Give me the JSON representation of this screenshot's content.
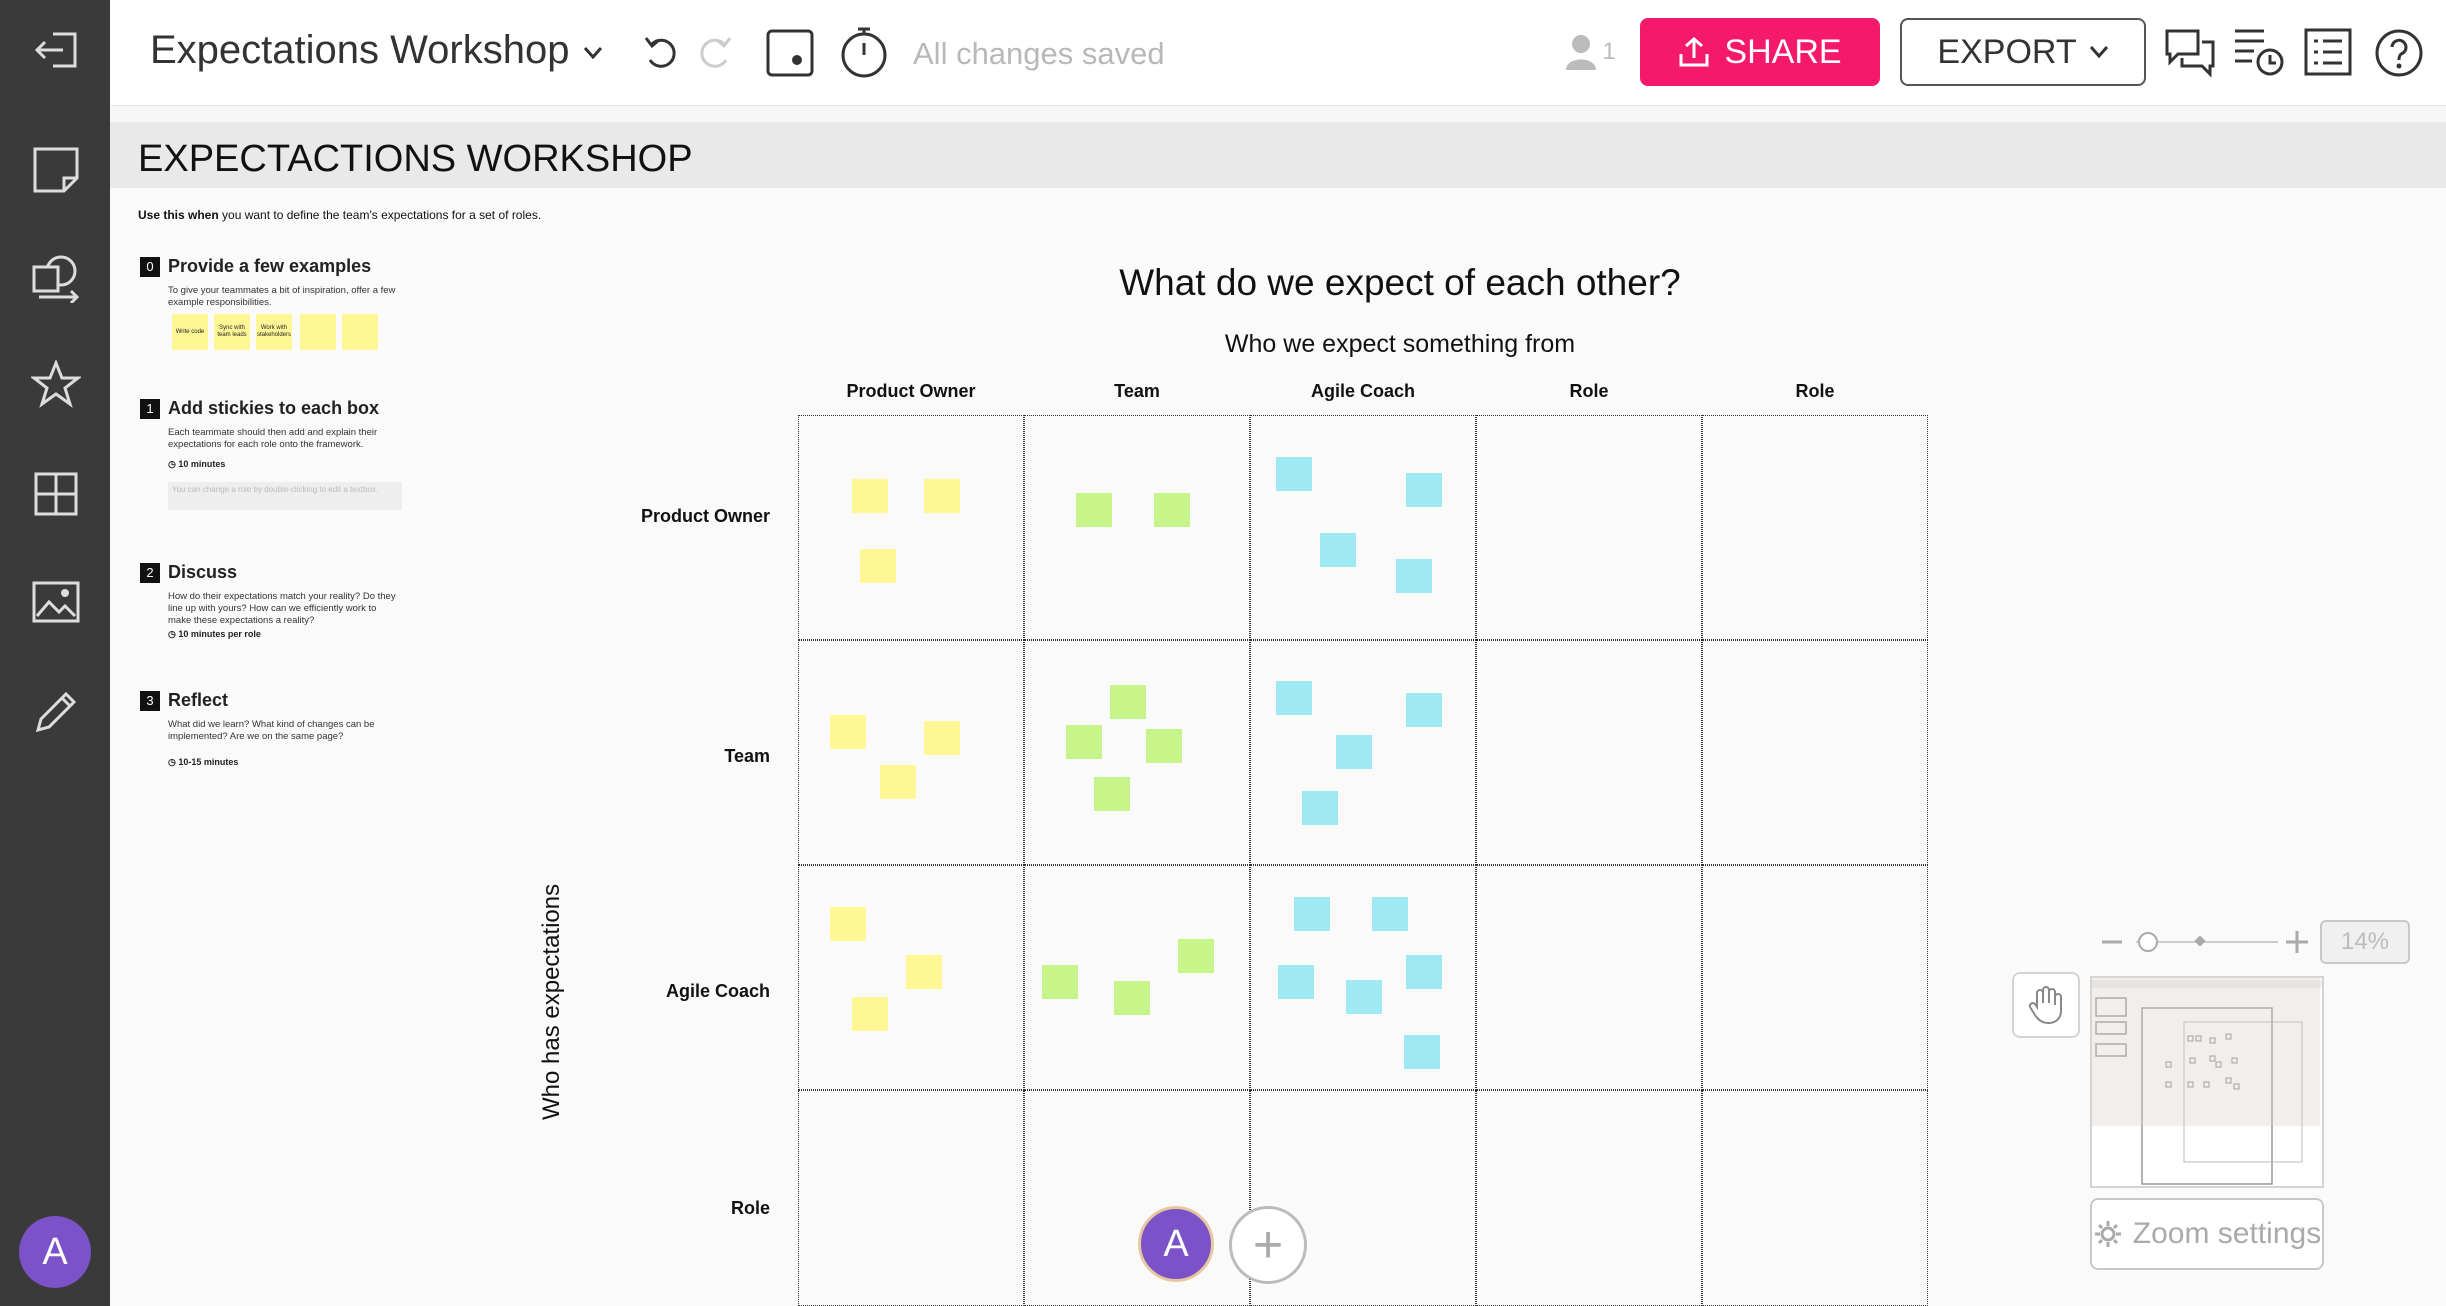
{
  "topbar": {
    "title": "Expectations Workshop",
    "saved_status": "All changes saved",
    "user_count": "1",
    "share_label": "SHARE",
    "export_label": "EXPORT"
  },
  "rail": {
    "avatar_initial": "A"
  },
  "board": {
    "title": "EXPECTACTIONS WORKSHOP",
    "intro_bold": "Use this when",
    "intro_rest": " you want to define the team's expectations for a set of roles.",
    "steps": [
      {
        "num": "0",
        "heading": "Provide a few examples",
        "desc": "To give your teammates a bit of inspiration, offer a few example responsibilities.",
        "time": ""
      },
      {
        "num": "1",
        "heading": "Add stickies to each box",
        "desc": "Each teammate should then add and explain their expectations for each role onto the framework.",
        "time": "10 minutes"
      },
      {
        "num": "2",
        "heading": "Discuss",
        "desc": "How do their expectations match your reality? Do they line up with yours? How can we efficiently work to make these expectations a reality?",
        "time": "10 minutes per role"
      },
      {
        "num": "3",
        "heading": "Reflect",
        "desc": "What did we learn? What kind of changes can be implemented? Are we on the same page?",
        "time": "10-15 minutes"
      }
    ],
    "example_stickies": [
      "Write code",
      "Sync with team leads",
      "Work with stakeholders",
      "",
      ""
    ],
    "hint_text": "You can change a role by double-clicking to edit a textbox.",
    "main_question": "What do we expect of each other?",
    "sub_question": "Who we expect something from",
    "columns": [
      "Product Owner",
      "Team",
      "Agile Coach",
      "Role",
      "Role"
    ],
    "rows": [
      "Product Owner",
      "Team",
      "Agile Coach",
      "Role"
    ],
    "vertical_label": "Who has expectations"
  },
  "zoom": {
    "percent": "14%",
    "settings_label": "Zoom settings",
    "level": 0.14
  },
  "collab": {
    "avatar_initial": "A",
    "add_label": "+"
  },
  "colors": {
    "share": "#f5196c",
    "rail": "#3a3a3a",
    "avatar": "#7b52c7",
    "sticky_yellow": "#fff796",
    "sticky_green": "#c7f58a",
    "sticky_cyan": "#9fe9f3"
  },
  "icons": [
    "exit-icon",
    "sticky-note-icon",
    "shapes-icon",
    "star-icon",
    "templates-icon",
    "image-icon",
    "pen-icon",
    "undo-icon",
    "redo-icon",
    "frame-icon",
    "timer-icon",
    "user-icon",
    "upload-icon",
    "chevron-down-icon",
    "comments-icon",
    "activity-icon",
    "outline-icon",
    "help-icon",
    "hand-icon",
    "gear-icon"
  ]
}
